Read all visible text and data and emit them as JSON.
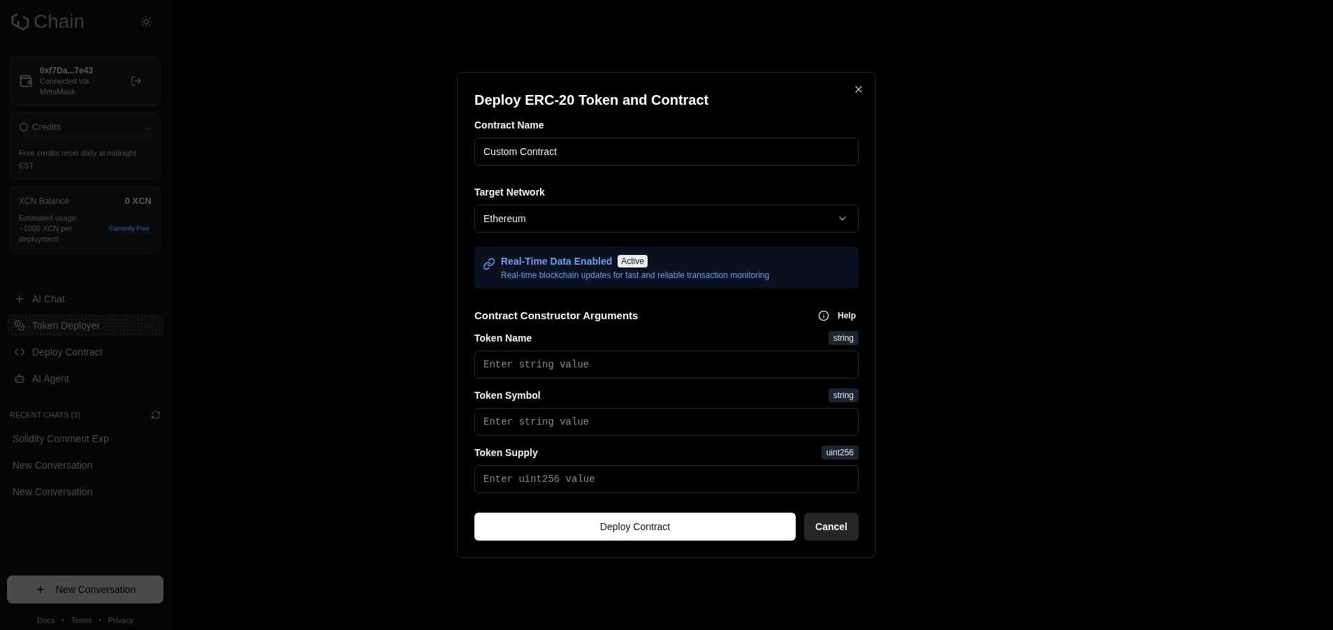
{
  "sidebar": {
    "logo": "Chain",
    "wallet": {
      "address": "0xf7Da...7e43",
      "status": "Connected via MetaMask"
    },
    "credits": {
      "title": "Credits",
      "menu": "...",
      "note": "Free credits reset daily at midnight EST"
    },
    "balance": {
      "label": "XCN Balance",
      "value": "0 XCN",
      "usage": "Estimated usage: ~1000 XCN per deployment",
      "badge": "Currently Free"
    },
    "nav": [
      {
        "label": "AI Chat",
        "kind": "plus",
        "selected": false
      },
      {
        "label": "Token Deployer",
        "kind": "coins",
        "selected": true
      },
      {
        "label": "Deploy Contract",
        "kind": "code",
        "selected": false
      },
      {
        "label": "AI Agent",
        "kind": "bot",
        "selected": false
      }
    ],
    "recent": {
      "title": "RECENT CHATS (3)",
      "chats": [
        "Solidity Comment Exp",
        "New Conversation",
        "New Conversation"
      ]
    },
    "new_button": "New Conversation",
    "footer": {
      "links": [
        "Docs",
        "Terms",
        "Privacy"
      ],
      "separator": "•"
    }
  },
  "dialog": {
    "title": "Deploy ERC-20 Token and Contract",
    "contract_name": {
      "label": "Contract Name",
      "value": "Custom Contract"
    },
    "network": {
      "label": "Target Network",
      "value": "Ethereum"
    },
    "realtime": {
      "title": "Real-Time Data Enabled",
      "badge": "Active",
      "description": "Real-time blockchain updates for fast and reliable transaction monitoring"
    },
    "arguments": {
      "title": "Contract Constructor Arguments",
      "help": "Help",
      "items": [
        {
          "label": "Token Name",
          "type": "string",
          "placeholder": "Enter string value"
        },
        {
          "label": "Token Symbol",
          "type": "string",
          "placeholder": "Enter string value"
        },
        {
          "label": "Token Supply",
          "type": "uint256",
          "placeholder": "Enter uint256 value"
        }
      ]
    },
    "deploy": "Deploy Contract",
    "cancel": "Cancel"
  }
}
